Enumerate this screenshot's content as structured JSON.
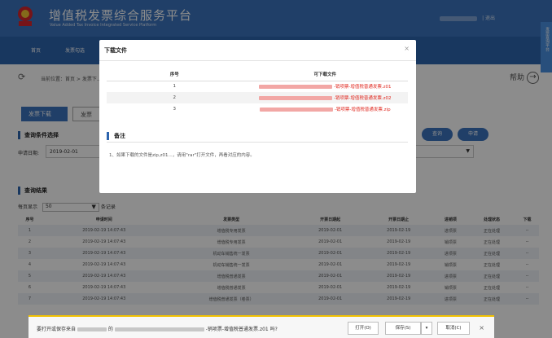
{
  "header": {
    "title": "增值税发票综合服务平台",
    "subtitle": "Value Added Tax Invoice Integrated Service Platform",
    "user_suffix": "| 退出"
  },
  "nav": {
    "items": [
      "首页",
      "发票勾选"
    ]
  },
  "side_tab": {
    "label": "发票查询平台"
  },
  "breadcrumb": {
    "text": "当前位置：首页 > 发票下..."
  },
  "help": {
    "label": "帮助"
  },
  "tabs": {
    "active": "发票下载",
    "inactive": "发票"
  },
  "query": {
    "section_title": "查询条件选择",
    "date_label": "申请日期:",
    "date_value": "2019-02-01",
    "query_button": "查询",
    "apply_button": "申请"
  },
  "results": {
    "section_title": "查询结果",
    "per_page_label": "每页显示",
    "per_page_value": "50",
    "per_page_suffix": "条记录",
    "headers": [
      "序号",
      "申请时间",
      "发票类型",
      "开票日期起",
      "开票日期止",
      "进销项",
      "处理状态",
      "下载"
    ],
    "rows": [
      [
        "1",
        "2019-02-19 14:07:43",
        "增值税专用发票",
        "2019-02-01",
        "2019-02-19",
        "进项票",
        "正在处理",
        "--"
      ],
      [
        "2",
        "2019-02-19 14:07:43",
        "增值税专用发票",
        "2019-02-01",
        "2019-02-19",
        "销项票",
        "正在处理",
        "--"
      ],
      [
        "3",
        "2019-02-19 14:07:43",
        "机动车销售统一发票",
        "2019-02-01",
        "2019-02-19",
        "进项票",
        "正在处理",
        "--"
      ],
      [
        "4",
        "2019-02-19 14:07:43",
        "机动车销售统一发票",
        "2019-02-01",
        "2019-02-19",
        "销项票",
        "正在处理",
        "--"
      ],
      [
        "5",
        "2019-02-19 14:07:43",
        "增值税普通发票",
        "2019-02-01",
        "2019-02-19",
        "进项票",
        "正在处理",
        "--"
      ],
      [
        "6",
        "2019-02-19 14:07:43",
        "增值税普通发票",
        "2019-02-01",
        "2019-02-19",
        "销项票",
        "正在处理",
        "--"
      ],
      [
        "7",
        "2019-02-19 14:07:43",
        "增值税普通发票（卷票）",
        "2019-02-01",
        "2019-02-19",
        "进项票",
        "正在处理",
        "--"
      ]
    ]
  },
  "modal": {
    "title": "下载文件",
    "close": "×",
    "headers": [
      "序号",
      "可下载文件"
    ],
    "files": [
      {
        "index": "1",
        "name": "-销项票-增值税普通发票.z01"
      },
      {
        "index": "2",
        "name": "-销项票-增值税普通发票.z02"
      },
      {
        "index": "3",
        "name": "-销项票-增值税普通发票.zip"
      }
    ],
    "note_title": "备注",
    "note_text": "1、如果下载的文件是zip,z01...，请用\"rar\"打开文件，再看对应的内容。"
  },
  "download_bar": {
    "prefix": "要打开或保存来自",
    "mid": "的",
    "filename": "-销项票-增值税普通发票.z01 吗?",
    "open": "打开(O)",
    "save": "保存(S)",
    "cancel": "取消(C)",
    "close": "×"
  },
  "colors": {
    "header_bg": "#3b73bd",
    "nav_bg": "#2d64ad",
    "accent": "#3b73bd",
    "file_link": "#e0281f",
    "download_bar_accent": "#f2c200"
  }
}
